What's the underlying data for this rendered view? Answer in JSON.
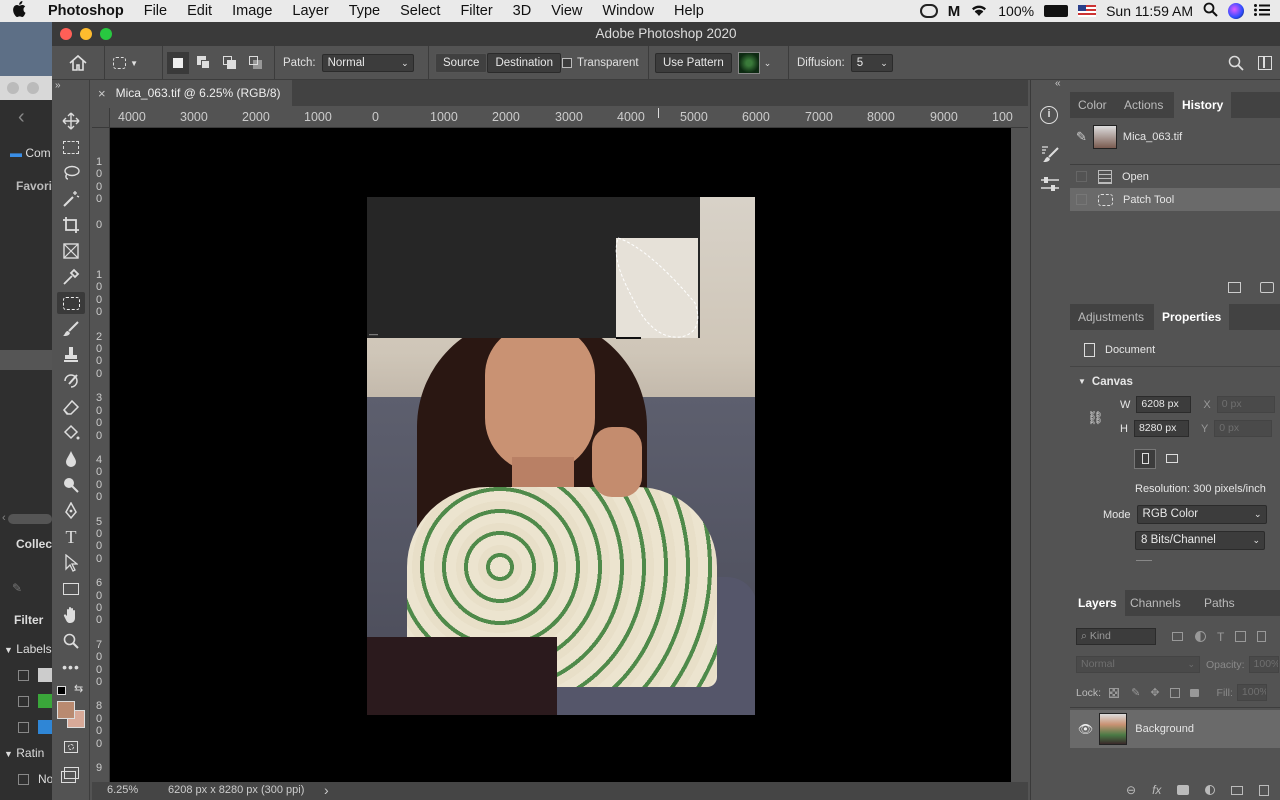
{
  "menubar": {
    "apple_icon": "apple-icon",
    "app": "Photoshop",
    "items": [
      "File",
      "Edit",
      "Image",
      "Layer",
      "Type",
      "Select",
      "Filter",
      "3D",
      "View",
      "Window",
      "Help"
    ],
    "battery": "100%",
    "datetime": "Sun 11:59 AM"
  },
  "window": {
    "title": "Adobe Photoshop 2020"
  },
  "options": {
    "patch_label": "Patch:",
    "patch_value": "Normal",
    "source": "Source",
    "destination": "Destination",
    "transparent": "Transparent",
    "use_pattern": "Use Pattern",
    "diffusion_label": "Diffusion:",
    "diffusion_value": "5"
  },
  "document": {
    "tab_title": "Mica_063.tif @ 6.25% (RGB/8)",
    "close": "×",
    "ruler_top": [
      "4000",
      "3000",
      "2000",
      "1000",
      "0",
      "1000",
      "2000",
      "3000",
      "4000",
      "5000",
      "6000",
      "7000",
      "8000",
      "9000",
      "100"
    ],
    "ruler_left": [
      "1",
      "0",
      "0",
      "0",
      "0",
      "1",
      "0",
      "0",
      "0",
      "2",
      "0",
      "0",
      "0",
      "3",
      "0",
      "0",
      "0",
      "4",
      "0",
      "0",
      "0",
      "5",
      "0",
      "0",
      "0",
      "6",
      "0",
      "0",
      "0",
      "7",
      "0",
      "0",
      "0",
      "8",
      "0",
      "0",
      "0",
      "9"
    ],
    "zoom": "6.25%",
    "doc_info": "6208 px x 8280 px (300 ppi)",
    "status_arrow": "›"
  },
  "bgapp": {
    "com": "Com",
    "favorites": "Favori",
    "collections": "Collec",
    "filter": "Filter",
    "labels": "Labels",
    "ratings": "Ratin",
    "no": "No"
  },
  "history_panel": {
    "tabs": [
      "Color",
      "Actions",
      "History"
    ],
    "snapshot": "Mica_063.tif",
    "states": [
      "Open",
      "Patch Tool"
    ]
  },
  "properties_panel": {
    "tabs": [
      "Adjustments",
      "Properties"
    ],
    "type": "Document",
    "section": "Canvas",
    "w_label": "W",
    "w_value": "6208 px",
    "h_label": "H",
    "h_value": "8280 px",
    "x_label": "X",
    "x_value": "0 px",
    "y_label": "Y",
    "y_value": "0 px",
    "resolution": "Resolution: 300 pixels/inch",
    "mode_label": "Mode",
    "mode_value": "RGB Color",
    "bits_value": "8 Bits/Channel"
  },
  "layers_panel": {
    "tabs": [
      "Layers",
      "Channels",
      "Paths"
    ],
    "kind": "Kind",
    "blend": "Normal",
    "opacity_label": "Opacity:",
    "opacity_value": "100%",
    "lock_label": "Lock:",
    "fill_label": "Fill:",
    "fill_value": "100%",
    "layer_name": "Background"
  },
  "colors": {
    "foreground": "#b98a70",
    "background": "#d8a998",
    "accent": "#2f6fbf"
  }
}
